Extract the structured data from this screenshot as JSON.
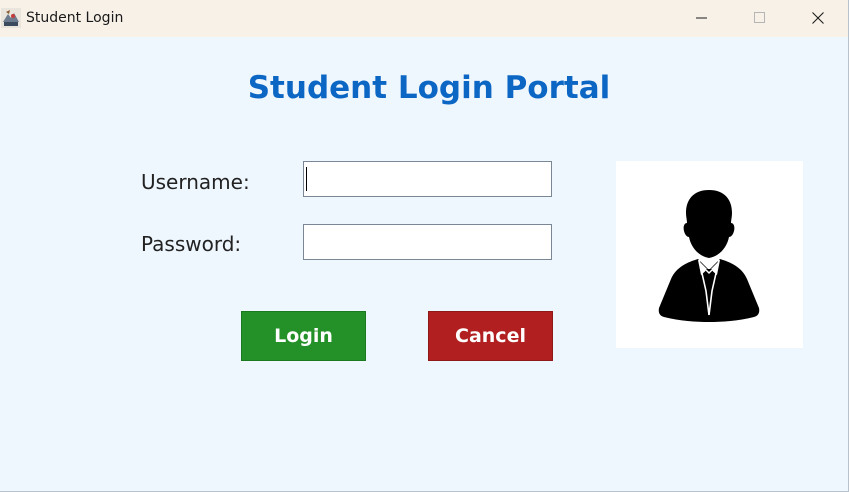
{
  "window": {
    "title": "Student Login",
    "app_icon": "java-app-icon",
    "controls": {
      "minimize_icon": "minimize-icon",
      "maximize_icon": "maximize-icon",
      "close_icon": "close-icon"
    }
  },
  "portal": {
    "title": "Student Login Portal",
    "title_color": "#0c66c4",
    "background": "#eff7fe"
  },
  "form": {
    "username_label": "Username:",
    "username_value": "",
    "password_label": "Password:",
    "password_value": ""
  },
  "buttons": {
    "login_label": "Login",
    "login_color": "#239127",
    "cancel_label": "Cancel",
    "cancel_color": "#b11f20"
  },
  "avatar": {
    "icon": "user-avatar-icon"
  }
}
